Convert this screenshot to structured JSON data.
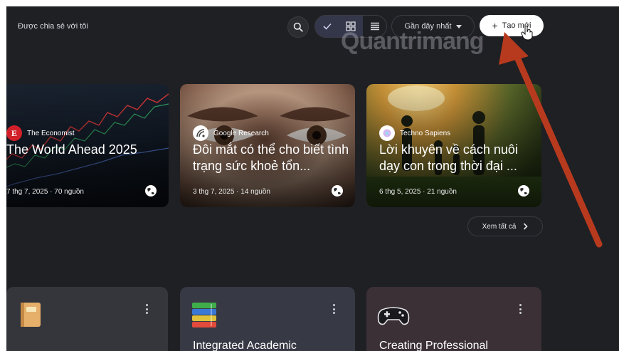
{
  "header": {
    "shared_label": "Được chia sẻ với tôi",
    "sort_label": "Gần đây nhất",
    "create_label": "Tạo mới",
    "watermark": "Quantrimang"
  },
  "featured": [
    {
      "source": "The Economist",
      "source_logo": "E",
      "title": "The World Ahead 2025",
      "meta": "7 thg 7, 2025 · 70 nguồn"
    },
    {
      "source": "Google Research",
      "title": "Đôi mắt có thể cho biết tình trạng sức khoẻ tổn...",
      "meta": "3 thg 7, 2025 · 14 nguồn"
    },
    {
      "source": "Techno Sapiens",
      "title": "Lời khuyên về cách nuôi dạy con trong thời đại ...",
      "meta": "6 thg 5, 2025 · 21 nguồn"
    }
  ],
  "see_all_label": "Xem tất cả",
  "notebooks": [
    {
      "title": "",
      "emoji": "book-icon"
    },
    {
      "title": "Integrated Academic",
      "emoji": "books-stack-icon"
    },
    {
      "title": "Creating Professional",
      "emoji": "gamepad-icon"
    }
  ],
  "colors": {
    "background": "#1f2024",
    "annotation_arrow": "#b83a1e"
  }
}
